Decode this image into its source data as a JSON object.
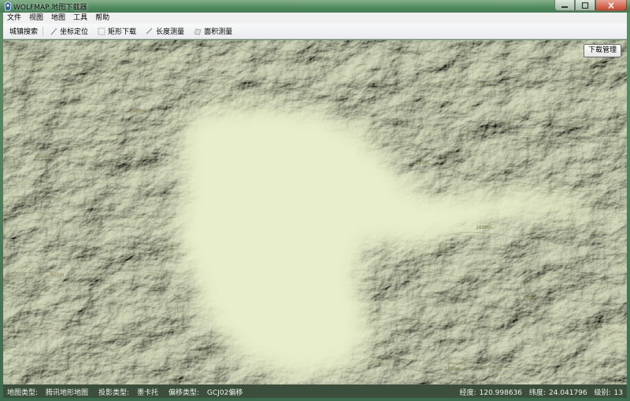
{
  "window": {
    "title": "WOLFMAP 地图下载器"
  },
  "menu": [
    "文件",
    "视图",
    "地图",
    "工具",
    "帮助"
  ],
  "toolbar": [
    {
      "label": "城镇搜索",
      "icon": "search-icon"
    },
    {
      "label": "坐标定位",
      "icon": "pin-icon"
    },
    {
      "label": "矩形下载",
      "icon": "rectangle-icon"
    },
    {
      "label": "长度测量",
      "icon": "ruler-icon"
    },
    {
      "label": "面积测量",
      "icon": "area-icon"
    }
  ],
  "map": {
    "download_manager_label": "下载管理",
    "contour_labels": [
      "1000m",
      "1200m",
      "1400m",
      "1600m",
      "800m"
    ]
  },
  "status": {
    "map_type_label": "地图类型:",
    "map_type": "腾讯地形地图",
    "projection_label": "投影类型:",
    "projection": "墨卡托",
    "offset_label": "偏移类型:",
    "offset": "GCJ02偏移",
    "longitude_label": "经度:",
    "longitude": "120.998636",
    "latitude_label": "纬度:",
    "latitude": "24.041796",
    "level_label": "级别:",
    "level": "13"
  },
  "colors": {
    "map_plain": "#e8eecb",
    "map_relief_dark": "#5e6a4e",
    "map_relief_light": "#d9e0b8",
    "contour": "#9a8a64"
  }
}
